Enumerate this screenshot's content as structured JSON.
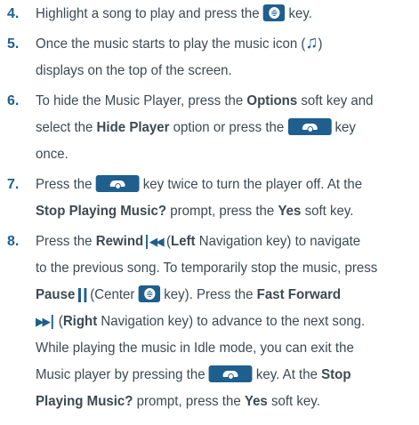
{
  "steps": [
    {
      "number": "4.",
      "lines": [
        [
          "Highlight a song to play and press the",
          " key."
        ]
      ]
    },
    {
      "number": "5.",
      "lines": [
        [
          "Once the music starts to play the music icon (",
          ")"
        ],
        [
          "displays on the top of the screen."
        ]
      ]
    },
    {
      "number": "6.",
      "lines": [
        [
          "To hide the Music Player, press the ",
          "Options",
          " soft key and"
        ],
        [
          "select the ",
          "Hide Player",
          " option or press the",
          " key"
        ],
        [
          "once."
        ]
      ]
    },
    {
      "number": "7.",
      "lines": [
        [
          "Press the",
          " key twice to turn the player off. At the"
        ],
        [
          "Stop Playing Music?",
          " prompt, press the ",
          "Yes",
          " soft key."
        ]
      ]
    },
    {
      "number": "8.",
      "lines": [
        [
          "Press the ",
          "Rewind",
          "(",
          "Left",
          " Navigation key) to navigate"
        ],
        [
          "to the previous song. To temporarily stop the music, press"
        ],
        [
          "Pause",
          "(Center",
          " key). Press the ",
          "Fast Forward"
        ],
        [
          "(",
          "Right",
          " Navigation key) to advance to the next song."
        ],
        [
          "While playing the music in Idle mode, you can exit the"
        ],
        [
          "Music player by pressing the",
          " key. At the ",
          "Stop"
        ],
        [
          "Playing Music?",
          " prompt, press the ",
          "Yes",
          " soft key."
        ]
      ]
    }
  ],
  "icons": {
    "menu_key": "menu-ok-key-icon",
    "end_key": "end-power-key-icon",
    "music": "music-note-icon",
    "rewind": "rewind-icon",
    "pause": "pause-icon",
    "fast_forward": "fast-forward-icon"
  },
  "colors": {
    "accent": "#1f5f8e",
    "text": "#3c4a52"
  }
}
